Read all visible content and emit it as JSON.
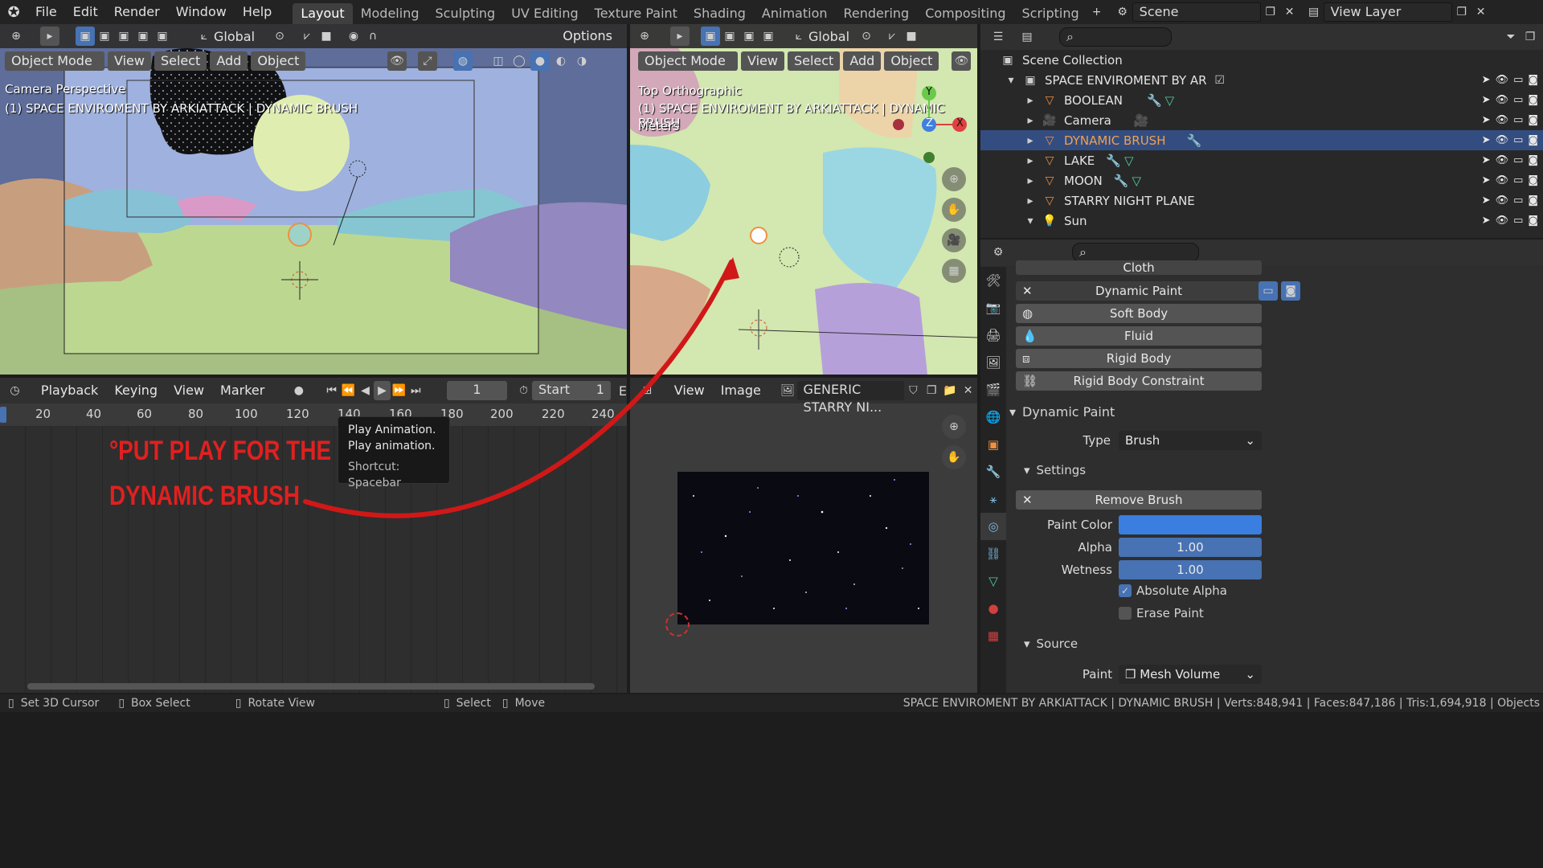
{
  "topbar": {
    "menus": [
      "File",
      "Edit",
      "Render",
      "Window",
      "Help"
    ],
    "workspaces": [
      "Layout",
      "Modeling",
      "Sculpting",
      "UV Editing",
      "Texture Paint",
      "Shading",
      "Animation",
      "Rendering",
      "Compositing",
      "Scripting"
    ],
    "active_workspace": "Layout",
    "scene": "Scene",
    "view_layer": "View Layer"
  },
  "viewport_left": {
    "transform_orientation": "Global",
    "options": "Options",
    "mode": "Object Mode",
    "menus": [
      "View",
      "Select",
      "Add",
      "Object"
    ],
    "overlay_line1": "Camera Perspective",
    "overlay_line2": "(1) SPACE ENVIROMENT BY ARKIATTACK | DYNAMIC BRUSH"
  },
  "viewport_right": {
    "transform_orientation": "Global",
    "mode": "Object Mode",
    "menus": [
      "View",
      "Select",
      "Add",
      "Object"
    ],
    "overlay_line1": "Top Orthographic",
    "overlay_line2": "(1) SPACE ENVIROMENT BY ARKIATTACK | DYNAMIC BRUSH",
    "overlay_line3": "Meters",
    "axes": {
      "y": "Y",
      "z": "Z",
      "x": "X"
    }
  },
  "timeline": {
    "menus": [
      "Playback",
      "Keying",
      "View",
      "Marker"
    ],
    "current_frame": "1",
    "start_label": "Start",
    "start_value": "1",
    "end_label": "E",
    "ruler": [
      "20",
      "40",
      "60",
      "80",
      "100",
      "120",
      "140",
      "160",
      "180",
      "200",
      "220",
      "240"
    ],
    "annotation_line1": "°PUT PLAY FOR THE",
    "annotation_line2": "DYNAMIC BRUSH",
    "tooltip": {
      "title": "Play Animation.",
      "desc": "Play animation.",
      "shortcut": "Shortcut: Spacebar"
    }
  },
  "image_editor": {
    "menus": [
      "View",
      "Image"
    ],
    "image_name": "GENERIC STARRY NI..."
  },
  "outliner": {
    "root": "Scene Collection",
    "collection": "SPACE ENVIROMENT BY AR",
    "items": [
      {
        "name": "BOOLEAN",
        "selected": false
      },
      {
        "name": "Camera",
        "selected": false
      },
      {
        "name": "DYNAMIC BRUSH",
        "selected": true
      },
      {
        "name": "LAKE",
        "selected": false
      },
      {
        "name": "MOON",
        "selected": false
      },
      {
        "name": "STARRY NIGHT PLANE",
        "selected": false
      },
      {
        "name": "Sun",
        "selected": false
      }
    ]
  },
  "properties": {
    "physics_buttons": [
      "Cloth",
      "Dynamic Paint",
      "Soft Body",
      "Fluid",
      "Rigid Body",
      "Rigid Body Constraint"
    ],
    "panel_title": "Dynamic Paint",
    "type_label": "Type",
    "type_value": "Brush",
    "settings_title": "Settings",
    "remove_brush": "Remove Brush",
    "paint_color_label": "Paint Color",
    "paint_color": "#3a7ee0",
    "alpha_label": "Alpha",
    "alpha_value": "1.00",
    "wetness_label": "Wetness",
    "wetness_value": "1.00",
    "absolute_alpha": "Absolute Alpha",
    "erase_paint": "Erase Paint",
    "source_title": "Source",
    "paint_label": "Paint",
    "paint_value": "Mesh Volume"
  },
  "statusbar": {
    "left": [
      "Set 3D Cursor",
      "Box Select",
      "Rotate View",
      "Select",
      "Move"
    ],
    "right": "SPACE ENVIROMENT BY ARKIATTACK | DYNAMIC BRUSH | Verts:848,941 | Faces:847,186 | Tris:1,694,918 | Objects"
  },
  "colors": {
    "accent": "#4772b3",
    "selection": "#334d80",
    "annotation": "#e02020"
  }
}
